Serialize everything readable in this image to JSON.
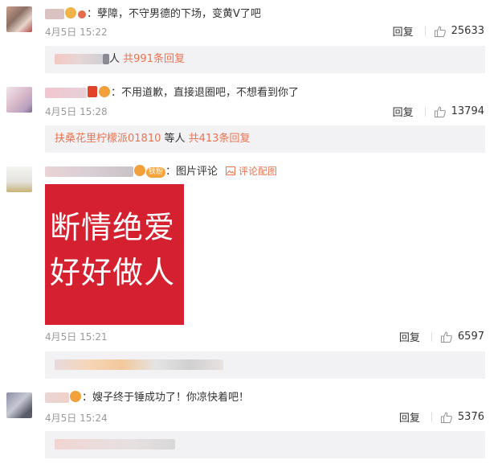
{
  "comments": [
    {
      "text": "：孽障，不守男德的下场，变黄V了吧",
      "time": "4月5日 15:22",
      "reply_label": "回复",
      "likes": "25633",
      "sub": {
        "prefix": "人",
        "count_text": "共991条回复"
      }
    },
    {
      "text": "：不用道歉，直接退圈吧，不想看到你了",
      "time": "4月5日 15:28",
      "reply_label": "回复",
      "likes": "13794",
      "sub": {
        "user": "扶桑花里柠檬派01810",
        "mid": " 等人 ",
        "count_text": "共413条回复"
      }
    },
    {
      "fan_badge": "铁粉",
      "text": "：图片评论",
      "pic_link": "评论配图",
      "card_lines": [
        "断情绝爱",
        "好好做人"
      ],
      "time": "4月5日 15:21",
      "reply_label": "回复",
      "likes": "6597"
    },
    {
      "text": "：嫂子终于锤成功了！你凉快着吧！",
      "time": "4月5日 15:24",
      "reply_label": "回复",
      "likes": "5376"
    }
  ],
  "colors": {
    "accent": "#eb7350",
    "card_red": "#d4202f",
    "subbox_bg": "#f2f2f5"
  }
}
